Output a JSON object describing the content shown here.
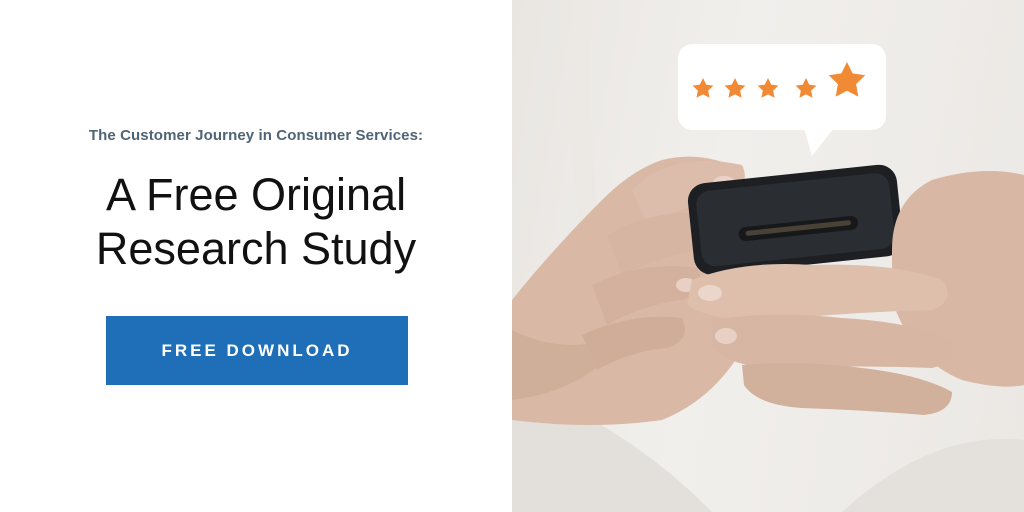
{
  "promo": {
    "eyebrow": "The Customer Journey in Consumer Services:",
    "headline_line1": "A Free Original",
    "headline_line2": "Research Study",
    "cta_label": "FREE DOWNLOAD"
  },
  "photo": {
    "subject": "hands-holding-phone-icon",
    "rating_stars": 5,
    "star_color": "#f08a35",
    "accent_color": "#1e6fb8"
  }
}
